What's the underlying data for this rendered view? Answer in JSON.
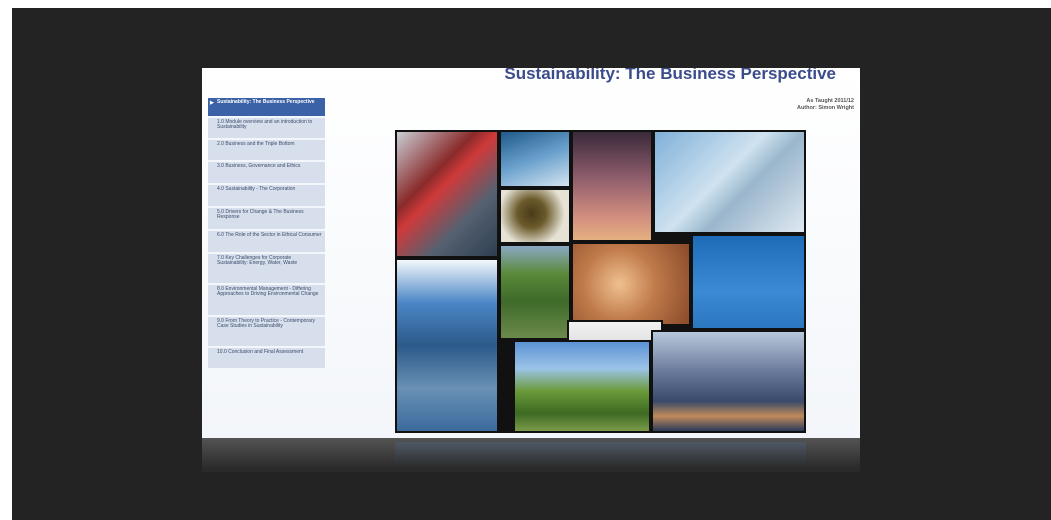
{
  "slide": {
    "title": "Sustainability: The Business Perspective",
    "meta_line1": "As Taught 2011/12",
    "meta_line2": "Author: Simon Wright"
  },
  "toc": {
    "items": [
      {
        "label": "Sustainability: The Business Perspective",
        "active": true
      },
      {
        "label": "1.0 Module overview and an introduction to Sustainability"
      },
      {
        "label": "2.0 Business and the Triple Bottom"
      },
      {
        "label": "3.0 Business, Governance and Ethics"
      },
      {
        "label": "4.0 Sustainability - The Corporation"
      },
      {
        "label": "5.0 Drivers for Change & The Business Response"
      },
      {
        "label": "6.0 The Role of the Sector in Ethical Consumer"
      },
      {
        "label": "7.0 Key Challenges for Corporate Sustainability: Energy, Water, Waste"
      },
      {
        "label": "8.0 Environmental Management - Differing Approaches to Driving Environmental Change"
      },
      {
        "label": "9.0 From Theory to Practice - Contemporary Case Studies in Sustainability"
      },
      {
        "label": "10.0 Conclusion and Final Assessment"
      }
    ]
  },
  "collage": {
    "tiles": [
      {
        "name": "fuel-station-photo",
        "color": "#8a2a2a"
      },
      {
        "name": "cyclist-photo",
        "color": "#4c7aa4"
      },
      {
        "name": "smokestacks-photo",
        "color": "#9a6a7a"
      },
      {
        "name": "glass-building-photo",
        "color": "#8fb4d4"
      },
      {
        "name": "tree-roots-photo",
        "color": "#5a4a2a"
      },
      {
        "name": "wind-turbine-photo",
        "color": "#2e7fc8"
      },
      {
        "name": "highway-sky-photo",
        "color": "#3a6fa8"
      },
      {
        "name": "farm-field-photo",
        "color": "#4e7a3a"
      },
      {
        "name": "grain-closeup-photo",
        "color": "#c07a4a"
      },
      {
        "name": "logo-photo",
        "color": "#d8d8d8"
      },
      {
        "name": "grassland-photo",
        "color": "#5a8a3a"
      },
      {
        "name": "city-skyline-photo",
        "color": "#4a5a7a"
      }
    ]
  }
}
